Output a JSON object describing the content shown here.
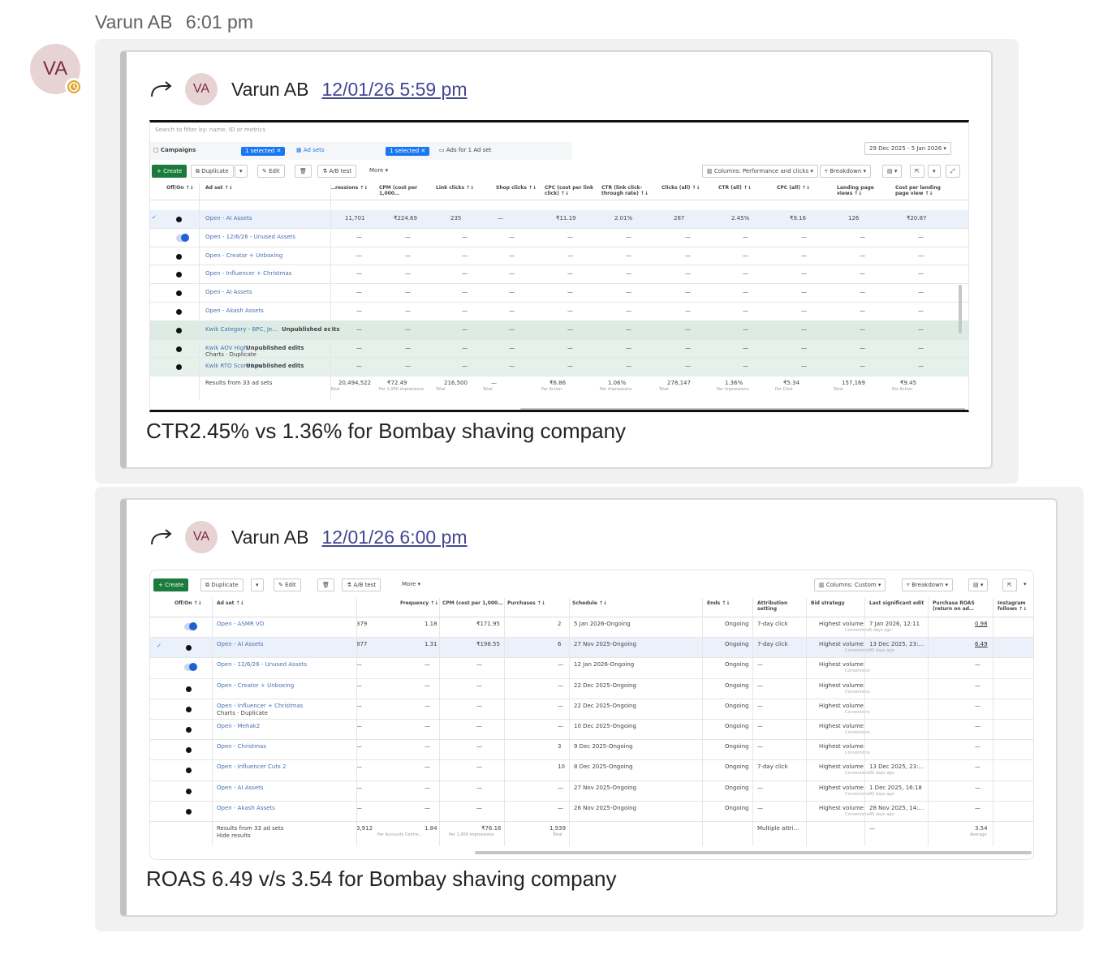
{
  "header": {
    "sender": "Varun AB",
    "time": "6:01 pm"
  },
  "avatar": {
    "initials": "VA"
  },
  "messages": [
    {
      "forward": {
        "initials": "VA",
        "name": "Varun AB",
        "timestamp": "12/01/26 5:59 pm"
      },
      "caption": "CTR2.45% vs 1.36% for Bombay shaving company",
      "screenshot": {
        "search_placeholder": "Search to filter by: name, ID or metrics",
        "tabs": {
          "campaigns": "Campaigns",
          "campaigns_badge": "1 selected ✕",
          "adsets": "Ad sets",
          "adsets_badge": "1 selected ✕",
          "ads": "Ads for 1 Ad set"
        },
        "date_range": "29 Dec 2025 - 5 Jan 2026",
        "toolbar": {
          "create": "+ Create",
          "duplicate": "Duplicate",
          "edit": "Edit",
          "abtest": "A/B test",
          "more": "More",
          "columns": "Columns: Performance and clicks",
          "breakdown": "Breakdown"
        },
        "columns": [
          "Off/On ↑↓",
          "Ad set ↑↓",
          "…ressions ↑↓",
          "CPM (cost per 1,000…",
          "Link clicks ↑↓",
          "Shop clicks ↑↓",
          "CPC (cost per link click) ↑↓",
          "CTR (link click-through rate) ↑↓",
          "Clicks (all) ↑↓",
          "CTR (all) ↑↓",
          "CPC (all) ↑↓",
          "Landing page views ↑↓",
          "Cost per landing page view ↑↓"
        ],
        "rows": [
          {
            "name": "Open - AI Assets",
            "values": [
              "11,701",
              "₹224.69",
              "235",
              "—",
              "₹11.19",
              "2.01%",
              "287",
              "2.45%",
              "₹9.16",
              "126",
              "₹20.87"
            ]
          },
          {
            "name": "Open - 12/6/26 - Unused Assets"
          },
          {
            "name": "Open - Creator + Unboxing"
          },
          {
            "name": "Open - Influencer + Christmas"
          },
          {
            "name": "Open - AI Assets"
          },
          {
            "name": "Open - Akash Assets"
          },
          {
            "name": "Kwik Category - BPC, Je…",
            "tag": "Unpublished edits"
          },
          {
            "name": "Kwik AOV High",
            "tag": "Unpublished edits",
            "sub": "Charts · Duplicate"
          },
          {
            "name": "Kwik RTO Score Low",
            "tag": "Unpublished edits"
          }
        ],
        "dash": "—",
        "totals": {
          "label": "Results from 33 ad sets",
          "values": [
            "20,494,522",
            "₹72.49",
            "216,500",
            "—",
            "₹6.86",
            "1.06%",
            "278,147",
            "1.36%",
            "₹5.34",
            "157,169",
            "₹9.45"
          ],
          "subs": [
            "Total",
            "Per 1,000 impressions",
            "Total",
            "Total",
            "Per Action",
            "Per impressions",
            "Total",
            "Per impressions",
            "Per Click",
            "Total",
            "Per Action"
          ]
        }
      }
    },
    {
      "forward": {
        "initials": "VA",
        "name": "Varun AB",
        "timestamp": "12/01/26 6:00 pm"
      },
      "caption": "ROAS 6.49 v/s 3.54 for Bombay shaving company",
      "screenshot": {
        "toolbar": {
          "create": "+ Create",
          "duplicate": "Duplicate",
          "edit": "Edit",
          "abtest": "A/B test",
          "more": "More",
          "columns": "Columns: Custom",
          "breakdown": "Breakdown"
        },
        "columns": [
          "Off/On ↑↓",
          "Ad set ↑↓",
          "Frequency ↑↓",
          "CPM (cost per 1,000…",
          "Purchases ↑↓",
          "Schedule ↑↓",
          "Ends ↑↓",
          "Attribution setting",
          "Bid strategy",
          "Last significant edit",
          "Purchase ROAS (return on ad…",
          "Instagram follows ↑↓"
        ],
        "rows": [
          {
            "name": "Open - ASMR VO",
            "imp": "379",
            "freq": "1.18",
            "cpm": "₹171.95",
            "purch": "2",
            "sched": "5 Jan 2026-Ongoing",
            "ends": "Ongoing",
            "attr": "7-day click",
            "bid": "Highest volume",
            "edit": "7 Jan 2026, 12:11",
            "edit_sub": "5 days ago",
            "roas": "0.98"
          },
          {
            "name": "Open - AI Assets",
            "imp": "877",
            "freq": "1.31",
            "cpm": "₹198.55",
            "purch": "6",
            "sched": "27 Nov 2025-Ongoing",
            "ends": "Ongoing",
            "attr": "7-day click",
            "bid": "Highest volume",
            "edit": "13 Dec 2025, 23:…",
            "edit_sub": "30 days ago",
            "roas": "6.49"
          },
          {
            "name": "Open - 12/6/26 - Unused Assets",
            "imp": "—",
            "freq": "—",
            "cpm": "—",
            "purch": "—",
            "sched": "12 Jan 2026-Ongoing",
            "ends": "Ongoing",
            "attr": "—",
            "bid": "Highest volume",
            "edit": "",
            "edit_sub": "",
            "roas": "—"
          },
          {
            "name": "Open - Creator + Unboxing",
            "imp": "—",
            "freq": "—",
            "cpm": "—",
            "purch": "—",
            "sched": "22 Dec 2025-Ongoing",
            "ends": "Ongoing",
            "attr": "—",
            "bid": "Highest volume",
            "edit": "",
            "edit_sub": "",
            "roas": "—"
          },
          {
            "name": "Open - Influencer + Christmas",
            "sub": "Charts · Duplicate",
            "imp": "—",
            "freq": "—",
            "cpm": "—",
            "purch": "—",
            "sched": "22 Dec 2025-Ongoing",
            "ends": "Ongoing",
            "attr": "—",
            "bid": "Highest volume",
            "edit": "",
            "edit_sub": "",
            "roas": "—"
          },
          {
            "name": "Open - Mehak2",
            "imp": "—",
            "freq": "—",
            "cpm": "—",
            "purch": "—",
            "sched": "10 Dec 2025-Ongoing",
            "ends": "Ongoing",
            "attr": "—",
            "bid": "Highest volume",
            "edit": "",
            "edit_sub": "",
            "roas": "—"
          },
          {
            "name": "Open - Christmas",
            "imp": "—",
            "freq": "—",
            "cpm": "—",
            "purch": "3",
            "sched": "9 Dec 2025-Ongoing",
            "ends": "Ongoing",
            "attr": "—",
            "bid": "Highest volume",
            "edit": "",
            "edit_sub": "",
            "roas": "—"
          },
          {
            "name": "Open - Influencer Cuts 2",
            "imp": "—",
            "freq": "—",
            "cpm": "—",
            "purch": "10",
            "sched": "8 Dec 2025-Ongoing",
            "ends": "Ongoing",
            "attr": "7-day click",
            "bid": "Highest volume",
            "edit": "13 Dec 2025, 23:…",
            "edit_sub": "30 days ago",
            "roas": "—"
          },
          {
            "name": "Open - AI Assets",
            "imp": "—",
            "freq": "—",
            "cpm": "—",
            "purch": "—",
            "sched": "27 Nov 2025-Ongoing",
            "ends": "Ongoing",
            "attr": "—",
            "bid": "Highest volume",
            "edit": "1 Dec 2025, 16:18",
            "edit_sub": "42 days ago",
            "roas": "—"
          },
          {
            "name": "Open - Akash Assets",
            "imp": "—",
            "freq": "—",
            "cpm": "—",
            "purch": "—",
            "sched": "26 Nov 2025-Ongoing",
            "ends": "Ongoing",
            "attr": "—",
            "bid": "Highest volume",
            "edit": "28 Nov 2025, 14:…",
            "edit_sub": "45 days ago",
            "roas": "—"
          }
        ],
        "bid_sub": "Conversions",
        "totals": {
          "label": "Results from 33 ad sets",
          "hide": "Hide results",
          "imp": "3,912",
          "freq": "1.84",
          "freq_sub": "Per Accounts Centre…",
          "cpm": "₹76.16",
          "cpm_sub": "Per 1,000 impressions",
          "purch": "1,939",
          "purch_sub": "Total",
          "attr": "Multiple attri…",
          "edit": "—",
          "roas": "3.54",
          "roas_sub": "Average"
        }
      }
    }
  ]
}
